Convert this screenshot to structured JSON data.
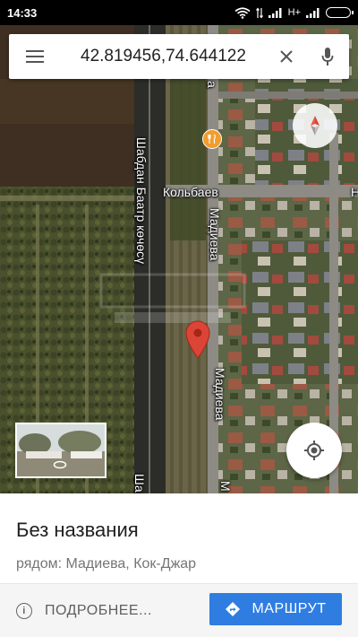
{
  "status_bar": {
    "time": "14:33",
    "network_type": "H+",
    "icons": [
      "wifi-icon",
      "data-arrows-icon",
      "signal-icon",
      "battery-icon"
    ]
  },
  "search": {
    "value": "42.819456,74.644122",
    "menu_icon": "hamburger-menu-icon",
    "clear_icon": "close-icon",
    "voice_icon": "microphone-icon"
  },
  "map": {
    "labels": {
      "street_main": "Шабдан Баатр көчөсү",
      "street_main_bottom": "Ша",
      "street_kolbaev": "Кольбаев",
      "street_kolbaev_cut": "Н",
      "street_madieva_top": "Мадиева",
      "street_madieva_mid": "Мадиева",
      "street_top_cut": "а",
      "street_bottom_cut": "М"
    },
    "poi_icon": "restaurant-icon",
    "marker_icon": "map-pin-icon",
    "compass_icon": "compass-icon",
    "location_icon": "my-location-icon",
    "streetview_icon": "rotate-360-icon",
    "colors": {
      "pin": "#db4437",
      "poi": "#f29d2c"
    }
  },
  "place": {
    "title": "Без названия",
    "subtitle": "рядом: Мадиева, Кок-Джар",
    "details_label": "ПОДРОБНЕЕ...",
    "route_label": "МАРШРУТ",
    "route_color": "#2f7de1"
  }
}
